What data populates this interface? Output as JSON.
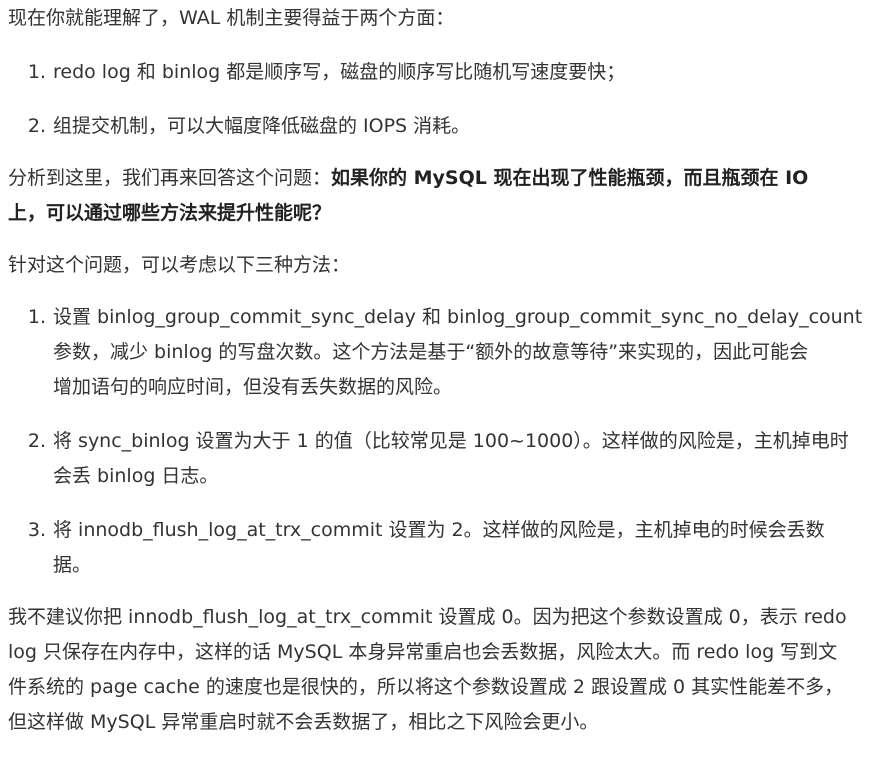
{
  "intro": "现在你就能理解了，WAL 机制主要得益于两个方面：",
  "benefits": [
    {
      "num": "1.",
      "text": "redo log 和 binlog 都是顺序写，磁盘的顺序写比随机写速度要快；"
    },
    {
      "num": "2.",
      "text": "组提交机制，可以大幅度降低磁盘的 IOPS 消耗。"
    }
  ],
  "question": {
    "lead": "分析到这里，我们再来回答这个问题：",
    "bold_line1": "如果你的 MySQL 现在出现了性能瓶颈，而且瓶颈在 IO",
    "bold_line2": "上，可以通过哪些方法来提升性能呢？"
  },
  "methods_intro": "针对这个问题，可以考虑以下三种方法：",
  "methods": [
    {
      "num": "1.",
      "lines": [
        "设置 binlog_group_commit_sync_delay 和 binlog_group_commit_sync_no_delay_count",
        "参数，减少 binlog 的写盘次数。这个方法是基于“额外的故意等待”来实现的，因此可能会",
        "增加语句的响应时间，但没有丢失数据的风险。"
      ]
    },
    {
      "num": "2.",
      "lines": [
        "将 sync_binlog 设置为大于 1 的值（比较常见是 100~1000）。这样做的风险是，主机掉电时",
        "会丢 binlog 日志。"
      ]
    },
    {
      "num": "3.",
      "lines": [
        "将 innodb_flush_log_at_trx_commit 设置为 2。这样做的风险是，主机掉电的时候会丢数",
        "据。"
      ]
    }
  ],
  "conclusion": [
    "我不建议你把 innodb_flush_log_at_trx_commit 设置成 0。因为把这个参数设置成 0，表示 redo",
    "log 只保存在内存中，这样的话 MySQL 本身异常重启也会丢数据，风险太大。而 redo log 写到文",
    "件系统的 page cache 的速度也是很快的，所以将这个参数设置成 2 跟设置成 0 其实性能差不多，",
    "但这样做 MySQL 异常重启时就不会丢数据了，相比之下风险会更小。"
  ]
}
